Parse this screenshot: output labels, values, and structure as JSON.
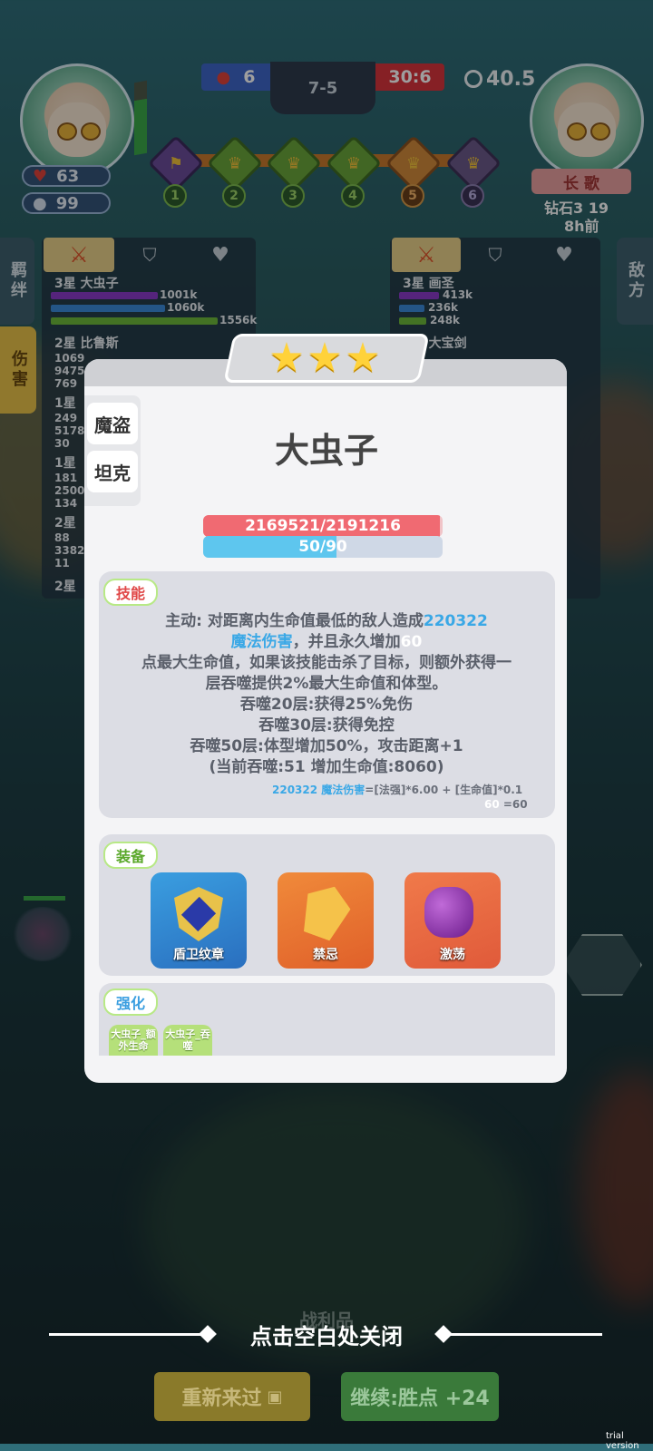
{
  "hud": {
    "left_score": "6",
    "round": "7-5",
    "right_score": "30:6",
    "timer": "40.5",
    "left_hp": "63",
    "left_gold": "99",
    "stages": [
      "1",
      "2",
      "3",
      "4",
      "5",
      "6"
    ],
    "opponent_name": "长 歌",
    "opponent_rank": "钻石3 19",
    "opponent_time": "8h前"
  },
  "side_tabs": {
    "bond": "羁绊",
    "damage": "伤害",
    "enemy": "敌方"
  },
  "left_list": [
    {
      "name": "3星 大虫子",
      "vals": [
        "1001k",
        "1060k",
        "1556k"
      ]
    },
    {
      "name": "2星 比鲁斯",
      "vals": [
        "1069",
        "9475",
        "769"
      ]
    },
    {
      "name": "1星",
      "vals": [
        "249",
        "5178",
        "30"
      ]
    },
    {
      "name": "1星",
      "vals": [
        "181",
        "2500",
        "134"
      ]
    },
    {
      "name": "2星",
      "vals": [
        "88",
        "3382",
        "11"
      ]
    },
    {
      "name": "2星",
      "vals": []
    }
  ],
  "right_list": [
    {
      "name": "3星 画圣",
      "vals": [
        "413k",
        "236k",
        "248k"
      ]
    },
    {
      "name": "2星 大宝剑",
      "vals": []
    }
  ],
  "modal": {
    "unit_name": "大虫子",
    "traits": [
      "魔盗",
      "坦克"
    ],
    "hp": "2169521/2191216",
    "hp_fraction": 0.99,
    "mana": "50/90",
    "mana_fraction": 0.556,
    "skill_title": "技能",
    "skill_lines": [
      [
        "主动: 对距离内生命值最低的敌人造成",
        "220322"
      ],
      [
        "魔法伤害",
        "，并且永久增加",
        "60"
      ],
      [
        "点最大生命值，如果该技能击杀了目标，则额外获得一"
      ],
      [
        "层吞噬提供2%最大生命值和体型。"
      ],
      [
        "吞噬20层:获得25%免伤"
      ],
      [
        "吞噬30层:获得免控"
      ],
      [
        "吞噬50层:体型增加50%，攻击距离+1"
      ],
      [
        "(当前吞噬:51 增加生命值:8060)"
      ]
    ],
    "formula_1a": "220322 魔法伤害",
    "formula_1b": "=[法强]*6.00 + [生命值]*0.1",
    "formula_2a": "60",
    "formula_2b": " =60",
    "equip_title": "装备",
    "equipment": [
      "盾卫纹章",
      "禁忌",
      "激荡"
    ],
    "enhance_title": "强化",
    "enhancements": [
      "大虫子_额外生命",
      "大虫子_吞噬"
    ]
  },
  "close_hint": "点击空白处关闭",
  "loot_label": "战利品",
  "retry_button": "重新来过",
  "continue_button": "继续:胜点 +24",
  "watermark": "trial version",
  "colors": {
    "hp": "#f06a72",
    "mana": "#5ec6ee",
    "highlight": "#3aa8e6",
    "accent_green": "#b5e07a"
  }
}
